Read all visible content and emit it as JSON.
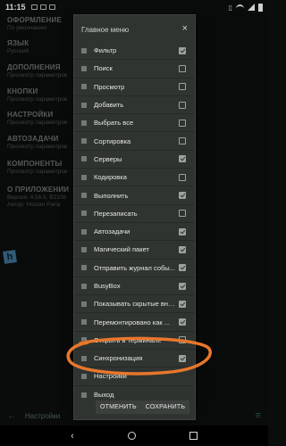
{
  "status_bar": {
    "time": "11:15"
  },
  "settings": {
    "items": [
      {
        "title": "ОФОРМЛЕНИЕ",
        "subtitle": "По умолчанию"
      },
      {
        "title": "ЯЗЫК",
        "subtitle": "Русский"
      },
      {
        "title": "ДОПОЛНЕНИЯ",
        "subtitle": "Просмотр параметров"
      },
      {
        "title": "КНОПКИ",
        "subtitle": "Просмотр параметров"
      },
      {
        "title": "НАСТРОЙКИ",
        "subtitle": "Просмотр параметров"
      },
      {
        "title": "АВТОЗАДАЧИ",
        "subtitle": "Просмотр параметров"
      },
      {
        "title": "КОМПОНЕНТЫ",
        "subtitle": "Просмотр параметров"
      },
      {
        "title": "О ПРИЛОЖЕНИИ",
        "subtitle": "Версия: 4.56.5. B210b",
        "subtitle2": "Автор: Houtan Paria"
      }
    ],
    "bottom_label": "Настройки"
  },
  "dialog": {
    "title": "Главное меню",
    "items": [
      {
        "label": "Фильтр",
        "checked": true
      },
      {
        "label": "Поиск",
        "checked": false
      },
      {
        "label": "Просмотр",
        "checked": false
      },
      {
        "label": "Добавить",
        "checked": false
      },
      {
        "label": "Выбрать все",
        "checked": false
      },
      {
        "label": "Сортировка",
        "checked": false
      },
      {
        "label": "Серверы",
        "checked": true
      },
      {
        "label": "Кодировка",
        "checked": false
      },
      {
        "label": "Выполнить",
        "checked": true
      },
      {
        "label": "Перезаписать",
        "checked": false
      },
      {
        "label": "Автозадачи",
        "checked": true
      },
      {
        "label": "Магический пакет",
        "checked": true
      },
      {
        "label": "Отправить журнал собы...",
        "checked": true
      },
      {
        "label": "BusyBox",
        "checked": true
      },
      {
        "label": "Показывать скрытые вне...",
        "checked": true
      },
      {
        "label": "Перемонтировано как ...",
        "checked": true
      },
      {
        "label": "Открыть в терминале",
        "checked": false
      },
      {
        "label": "Синхронизация",
        "checked": true
      },
      {
        "label": "Настройки",
        "checked": null
      },
      {
        "label": "Выход",
        "checked": null
      }
    ],
    "cancel_label": "ОТМЕНИТЬ",
    "save_label": "СОХРАНИТЬ"
  },
  "colors": {
    "annotation": "#e8772b",
    "accent": "#4a8a62"
  }
}
